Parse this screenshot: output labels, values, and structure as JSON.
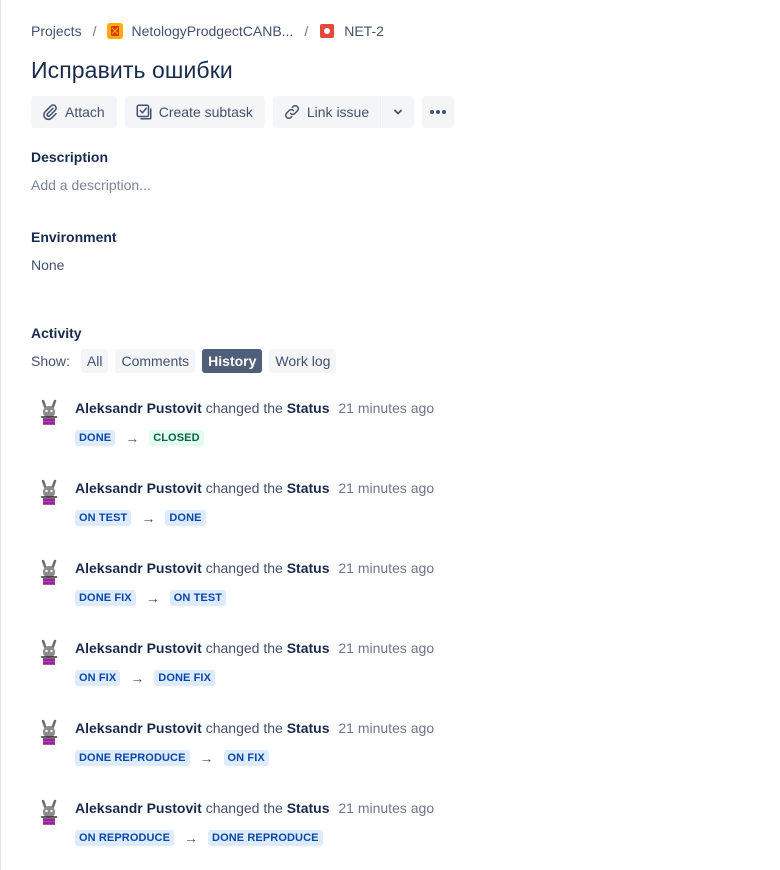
{
  "breadcrumbs": {
    "projects": "Projects",
    "project": "NetologyProdgectCANB...",
    "issue_key": "NET-2"
  },
  "title": "Исправить ошибки",
  "toolbar": {
    "attach": "Attach",
    "create_subtask": "Create subtask",
    "link_issue": "Link issue"
  },
  "description": {
    "label": "Description",
    "placeholder": "Add a description..."
  },
  "environment": {
    "label": "Environment",
    "value": "None"
  },
  "activity": {
    "label": "Activity",
    "show_label": "Show:",
    "filters": [
      "All",
      "Comments",
      "History",
      "Work log"
    ],
    "active_filter": "History",
    "entries": [
      {
        "author": "Aleksandr Pustovit",
        "action": "changed the",
        "field": "Status",
        "time": "21 minutes ago",
        "from": "DONE",
        "to": "CLOSED"
      },
      {
        "author": "Aleksandr Pustovit",
        "action": "changed the",
        "field": "Status",
        "time": "21 minutes ago",
        "from": "ON TEST",
        "to": "DONE"
      },
      {
        "author": "Aleksandr Pustovit",
        "action": "changed the",
        "field": "Status",
        "time": "21 minutes ago",
        "from": "DONE FIX",
        "to": "ON TEST"
      },
      {
        "author": "Aleksandr Pustovit",
        "action": "changed the",
        "field": "Status",
        "time": "21 minutes ago",
        "from": "ON FIX",
        "to": "DONE FIX"
      },
      {
        "author": "Aleksandr Pustovit",
        "action": "changed the",
        "field": "Status",
        "time": "21 minutes ago",
        "from": "DONE REPRODUCE",
        "to": "ON FIX"
      },
      {
        "author": "Aleksandr Pustovit",
        "action": "changed the",
        "field": "Status",
        "time": "21 minutes ago",
        "from": "ON REPRODUCE",
        "to": "DONE REPRODUCE"
      }
    ],
    "arrow": "→"
  },
  "colors": {
    "text": "#172b4d",
    "subtle": "#42526e",
    "active_filter_bg": "#505f79",
    "lozenge_blue_bg": "#deebff",
    "lozenge_blue_fg": "#0747a6",
    "lozenge_green_bg": "#e3fcef",
    "lozenge_green_fg": "#006644"
  },
  "icons": [
    "project-icon",
    "bug-icon",
    "paperclip-icon",
    "subtask-icon",
    "link-icon",
    "chevron-down-icon",
    "more-icon",
    "avatar-bunny-icon"
  ]
}
